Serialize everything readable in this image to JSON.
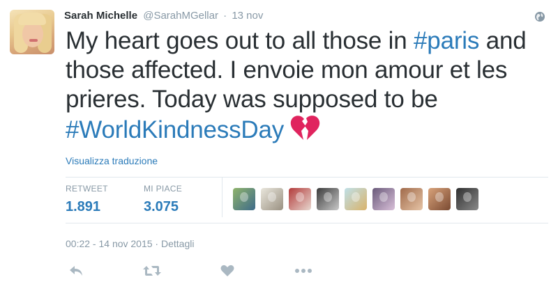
{
  "author": {
    "name": "Sarah Michelle",
    "handle": "@SarahMGellar",
    "separator": "·",
    "date_short": "13 nov"
  },
  "tweet": {
    "part1": "My heart goes out to all those in ",
    "hashtag1": "#paris",
    "part2": " and those affected. I envoie mon amour et les prieres. Today was supposed to be ",
    "hashtag2": "#WorldKindnessDay",
    "emoji": "broken-heart-icon"
  },
  "translate_link": "Visualizza traduzione",
  "stats": {
    "retweets_label": "RETWEET",
    "retweets_count": "1.891",
    "likes_label": "MI PIACE",
    "likes_count": "3.075"
  },
  "likers": [
    {
      "colors": [
        "#8fb36b",
        "#3e6b8a"
      ],
      "icon": "liker-avatar"
    },
    {
      "colors": [
        "#e9e6dc",
        "#9a9182"
      ],
      "icon": "liker-avatar"
    },
    {
      "colors": [
        "#b33b3b",
        "#e7d7cf"
      ],
      "icon": "liker-avatar"
    },
    {
      "colors": [
        "#3b3b3b",
        "#c9c9c9"
      ],
      "icon": "liker-avatar"
    },
    {
      "colors": [
        "#bfe0e8",
        "#d9b36b"
      ],
      "icon": "liker-avatar"
    },
    {
      "colors": [
        "#6a5a7a",
        "#d9c0d9"
      ],
      "icon": "liker-avatar"
    },
    {
      "colors": [
        "#a06a4a",
        "#e6c4a6"
      ],
      "icon": "liker-avatar"
    },
    {
      "colors": [
        "#d8a27a",
        "#7a4a32"
      ],
      "icon": "liker-avatar"
    },
    {
      "colors": [
        "#2f2f2f",
        "#8a8a8a"
      ],
      "icon": "liker-avatar"
    }
  ],
  "meta": {
    "timestamp": "00:22 - 14 nov 2015",
    "sep": " · ",
    "details": "Dettagli"
  },
  "colors": {
    "link": "#2b7bb9",
    "muted": "#8899a6",
    "heart": "#e0245e"
  },
  "actions": [
    "reply-icon",
    "retweet-icon",
    "like-icon",
    "more-icon"
  ]
}
